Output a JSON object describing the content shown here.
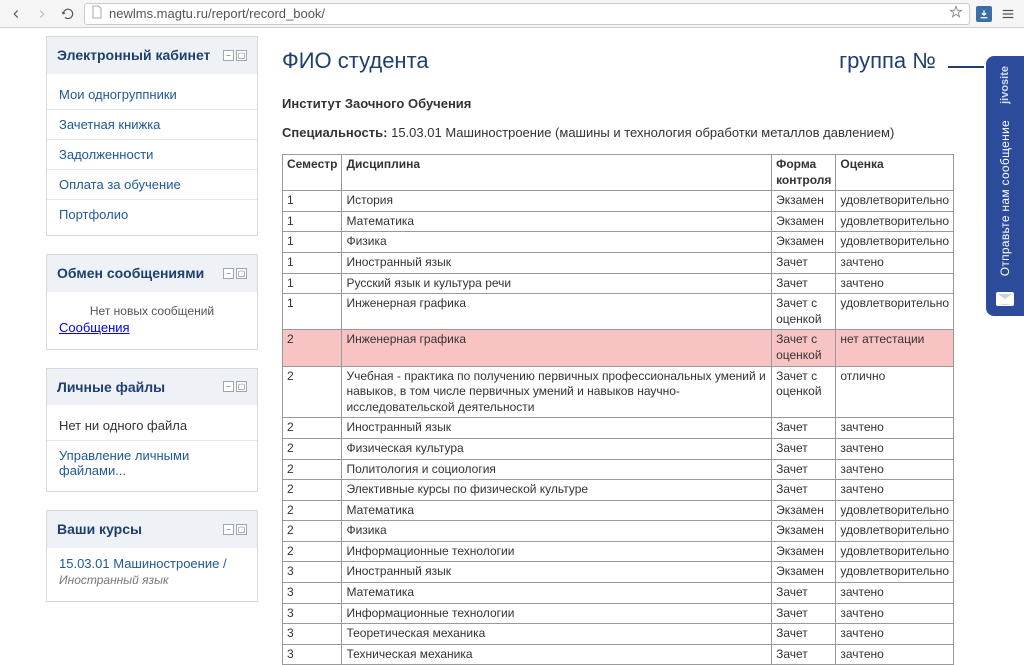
{
  "browser": {
    "url": "newlms.magtu.ru/report/record_book/"
  },
  "sidebar": {
    "blocks": [
      {
        "title": "Электронный кабинет",
        "items": [
          {
            "label": "Мои одногруппники"
          },
          {
            "label": "Зачетная книжка"
          },
          {
            "label": "Задолженности"
          },
          {
            "label": "Оплата за обучение"
          },
          {
            "label": "Портфолио"
          }
        ]
      },
      {
        "title": "Обмен сообщениями",
        "empty_text": "Нет новых сообщений",
        "link": "Сообщения"
      },
      {
        "title": "Личные файлы",
        "text": "Нет ни одного файла",
        "link": "Управление личными файлами..."
      },
      {
        "title": "Ваши курсы",
        "course": "15.03.01 Машиностроение /",
        "course_sub": "Иностранный язык"
      }
    ]
  },
  "main": {
    "student_label": "ФИО студента",
    "group_label": "группа №",
    "institute": "Институт Заочного Обучения",
    "spec_label": "Специальность:",
    "spec_value": "15.03.01 Машиностроение (машины и технология обработки металлов давлением)",
    "table": {
      "headers": [
        "Семестр",
        "Дисциплина",
        "Форма контроля",
        "Оценка"
      ],
      "rows": [
        {
          "sem": "1",
          "disc": "История",
          "form": "Экзамен",
          "grade": "удовлетворительно"
        },
        {
          "sem": "1",
          "disc": "Математика",
          "form": "Экзамен",
          "grade": "удовлетворительно"
        },
        {
          "sem": "1",
          "disc": "Физика",
          "form": "Экзамен",
          "grade": "удовлетворительно"
        },
        {
          "sem": "1",
          "disc": "Иностранный язык",
          "form": "Зачет",
          "grade": "зачтено"
        },
        {
          "sem": "1",
          "disc": "Русский язык и культура речи",
          "form": "Зачет",
          "grade": "зачтено"
        },
        {
          "sem": "1",
          "disc": "Инженерная графика",
          "form": "Зачет с оценкой",
          "grade": "удовлетворительно"
        },
        {
          "sem": "2",
          "disc": "Инженерная графика",
          "form": "Зачет с оценкой",
          "grade": "нет аттестации",
          "highlight": true
        },
        {
          "sem": "2",
          "disc": "Учебная - практика по получению первичных профессиональных умений и навыков, в том числе первичных умений и навыков научно-исследовательской деятельности",
          "form": "Зачет с оценкой",
          "grade": "отлично"
        },
        {
          "sem": "2",
          "disc": "Иностранный язык",
          "form": "Зачет",
          "grade": "зачтено"
        },
        {
          "sem": "2",
          "disc": "Физическая культура",
          "form": "Зачет",
          "grade": "зачтено"
        },
        {
          "sem": "2",
          "disc": "Политология и социология",
          "form": "Зачет",
          "grade": "зачтено"
        },
        {
          "sem": "2",
          "disc": "Элективные курсы по физической культуре",
          "form": "Зачет",
          "grade": "зачтено"
        },
        {
          "sem": "2",
          "disc": "Математика",
          "form": "Экзамен",
          "grade": "удовлетворительно"
        },
        {
          "sem": "2",
          "disc": "Физика",
          "form": "Экзамен",
          "grade": "удовлетворительно"
        },
        {
          "sem": "2",
          "disc": "Информационные технологии",
          "form": "Экзамен",
          "grade": "удовлетворительно"
        },
        {
          "sem": "3",
          "disc": "Иностранный язык",
          "form": "Экзамен",
          "grade": "удовлетворительно"
        },
        {
          "sem": "3",
          "disc": "Математика",
          "form": "Зачет",
          "grade": "зачтено"
        },
        {
          "sem": "3",
          "disc": "Информационные технологии",
          "form": "Зачет",
          "grade": "зачтено"
        },
        {
          "sem": "3",
          "disc": "Теоретическая механика",
          "form": "Зачет",
          "grade": "зачтено"
        },
        {
          "sem": "3",
          "disc": "Техническая механика",
          "form": "Зачет",
          "grade": "зачтено"
        }
      ]
    }
  },
  "jivo": {
    "brand": "jivosite",
    "text": "Отправьте нам сообщение"
  }
}
